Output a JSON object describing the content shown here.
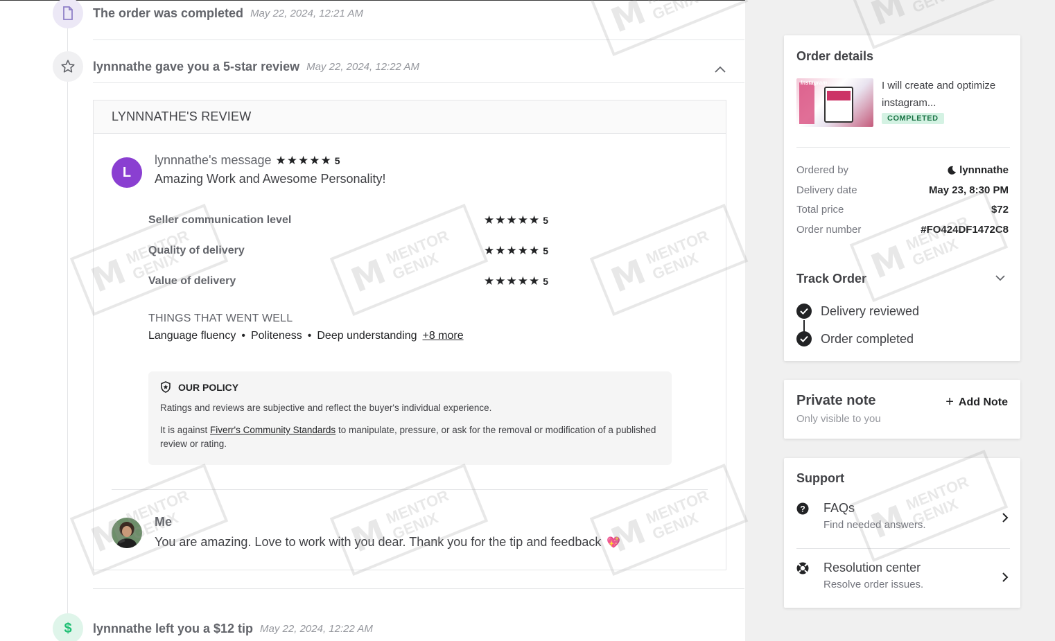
{
  "timeline": {
    "events": [
      {
        "title": "The order was completed",
        "time": "May 22, 2024, 12:21 AM",
        "icon": "document-icon"
      },
      {
        "title": "lynnnathe gave you a 5-star review",
        "time": "May 22, 2024, 12:22 AM",
        "icon": "star-icon"
      },
      {
        "title": "lynnnathe left you a $12 tip",
        "time": "May 22, 2024, 12:22 AM",
        "icon": "dollar-icon"
      }
    ]
  },
  "review": {
    "header": "LYNNNATHE'S REVIEW",
    "avatar_initial": "L",
    "author": "lynnnathe's message",
    "overall_stars": "★★★★★",
    "overall_score": "5",
    "message": "Amazing Work and Awesome Personality!",
    "ratings": [
      {
        "label": "Seller communication level",
        "stars": "★★★★★",
        "score": "5",
        "value": 5
      },
      {
        "label": "Quality of delivery",
        "stars": "★★★★★",
        "score": "5",
        "value": 5
      },
      {
        "label": "Value of delivery",
        "stars": "★★★★★",
        "score": "5",
        "value": 5
      }
    ],
    "went_well_title": "THINGS THAT WENT WELL",
    "went_well": [
      "Language fluency",
      "Politeness",
      "Deep understanding"
    ],
    "went_well_more": "+8 more",
    "policy": {
      "title": "OUR POLICY",
      "line1": "Ratings and reviews are subjective and reflect the buyer's individual experience.",
      "line2_pre": "It is against ",
      "line2_link": "Fiverr's Community Standards",
      "line2_post": " to manipulate, pressure, or ask for the removal or modification of a published review or rating."
    },
    "reply": {
      "author": "Me",
      "text": "You are amazing. Love to work with you dear. Thank you for the tip and feedback",
      "emoji": "💖"
    }
  },
  "order_details": {
    "title": "Order details",
    "gig_title": "I will create and optimize instagram...",
    "gig_thumb_text": "Instagram",
    "status": "COMPLETED",
    "rows": [
      {
        "key": "Ordered by",
        "value": "lynnnathe"
      },
      {
        "key": "Delivery date",
        "value": "May 23, 8:30 PM"
      },
      {
        "key": "Total price",
        "value": "$72"
      },
      {
        "key": "Order number",
        "value": "#FO424DF1472C8"
      }
    ],
    "track_title": "Track Order",
    "track_steps": [
      "Delivery reviewed",
      "Order completed"
    ]
  },
  "private_note": {
    "title": "Private note",
    "subtitle": "Only visible to you",
    "add_label": "Add Note"
  },
  "support": {
    "title": "Support",
    "items": [
      {
        "name": "FAQs",
        "desc": "Find needed answers.",
        "icon": "question-icon"
      },
      {
        "name": "Resolution center",
        "desc": "Resolve order issues.",
        "icon": "lifebuoy-icon"
      }
    ]
  },
  "watermark": {
    "text1": "MENTOR",
    "text2": "GENIX"
  },
  "colors": {
    "accent": "#222325",
    "avatar": "#8a3fd1",
    "badge_bg": "#d4f2e3",
    "badge_text": "#1a7345",
    "tip_icon_bg": "#dff5ea",
    "tip_icon": "#1dbf73"
  }
}
